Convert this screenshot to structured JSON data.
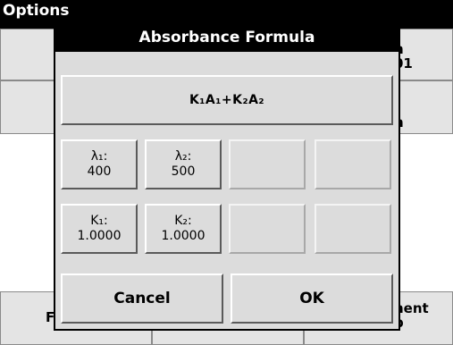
{
  "background_window": {
    "title": "Options",
    "right_top_label_line1": "n",
    "right_top_label_line2": "01",
    "right_mid_label": "h",
    "bottom_left_label": "F",
    "bottom_right_label_line1": "nent",
    "bottom_right_label_line2": "p"
  },
  "dialog": {
    "title": "Absorbance Formula",
    "formula_button": "K₁A₁+K₂A₂",
    "lambda1": {
      "label": "λ₁:",
      "value": "400"
    },
    "lambda2": {
      "label": "λ₂:",
      "value": "500"
    },
    "k1": {
      "label": "K₁:",
      "value": "1.0000"
    },
    "k2": {
      "label": "K₂:",
      "value": "1.0000"
    },
    "cancel": "Cancel",
    "ok": "OK"
  }
}
